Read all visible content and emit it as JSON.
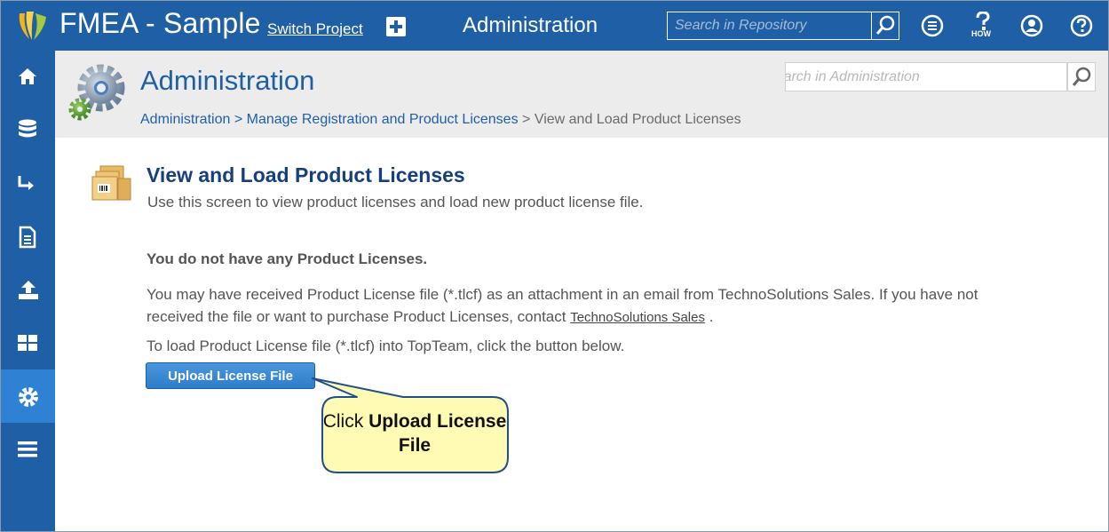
{
  "topbar": {
    "project_title": "FMEA - Sample",
    "switch_project": "Switch Project",
    "section_title": "Administration",
    "search_placeholder": "Search in Repository",
    "how_label": "HOW"
  },
  "header": {
    "title": "Administration",
    "search_placeholder": "Search in Administration",
    "breadcrumb": {
      "item1": "Administration",
      "sep1": " > ",
      "item2": "Manage Registration and Product Licenses",
      "sep2": " > ",
      "current": "View and Load Product Licenses"
    }
  },
  "main": {
    "title": "View and Load Product Licenses",
    "subtitle": "Use this screen to view product licenses and load new product license file.",
    "no_licenses": "You do not have any Product Licenses.",
    "info_text": "You may have received Product License file (*.tlcf) as an attachment in an email from TechnoSolutions Sales. If you have not received the file or want to purchase Product Licenses, contact ",
    "contact_link": "TechnoSolutions Sales",
    "info_end": " .",
    "load_text": "To load Product License file (*.tlcf) into TopTeam, click the button below.",
    "upload_button": "Upload License File"
  },
  "callout": {
    "prefix": "Click ",
    "emphasis": "Upload License File"
  },
  "sidebar": {
    "items": [
      "home-icon",
      "database-icon",
      "arrow-right-icon",
      "document-icon",
      "upload-icon",
      "dashboard-icon",
      "gear-icon",
      "menu-icon"
    ],
    "active_index": 6
  },
  "colors": {
    "brand_blue": "#1f5fa6",
    "active_blue": "#2f82d3",
    "header_grey": "#ececec",
    "callout_fill": "#fffbb5"
  }
}
